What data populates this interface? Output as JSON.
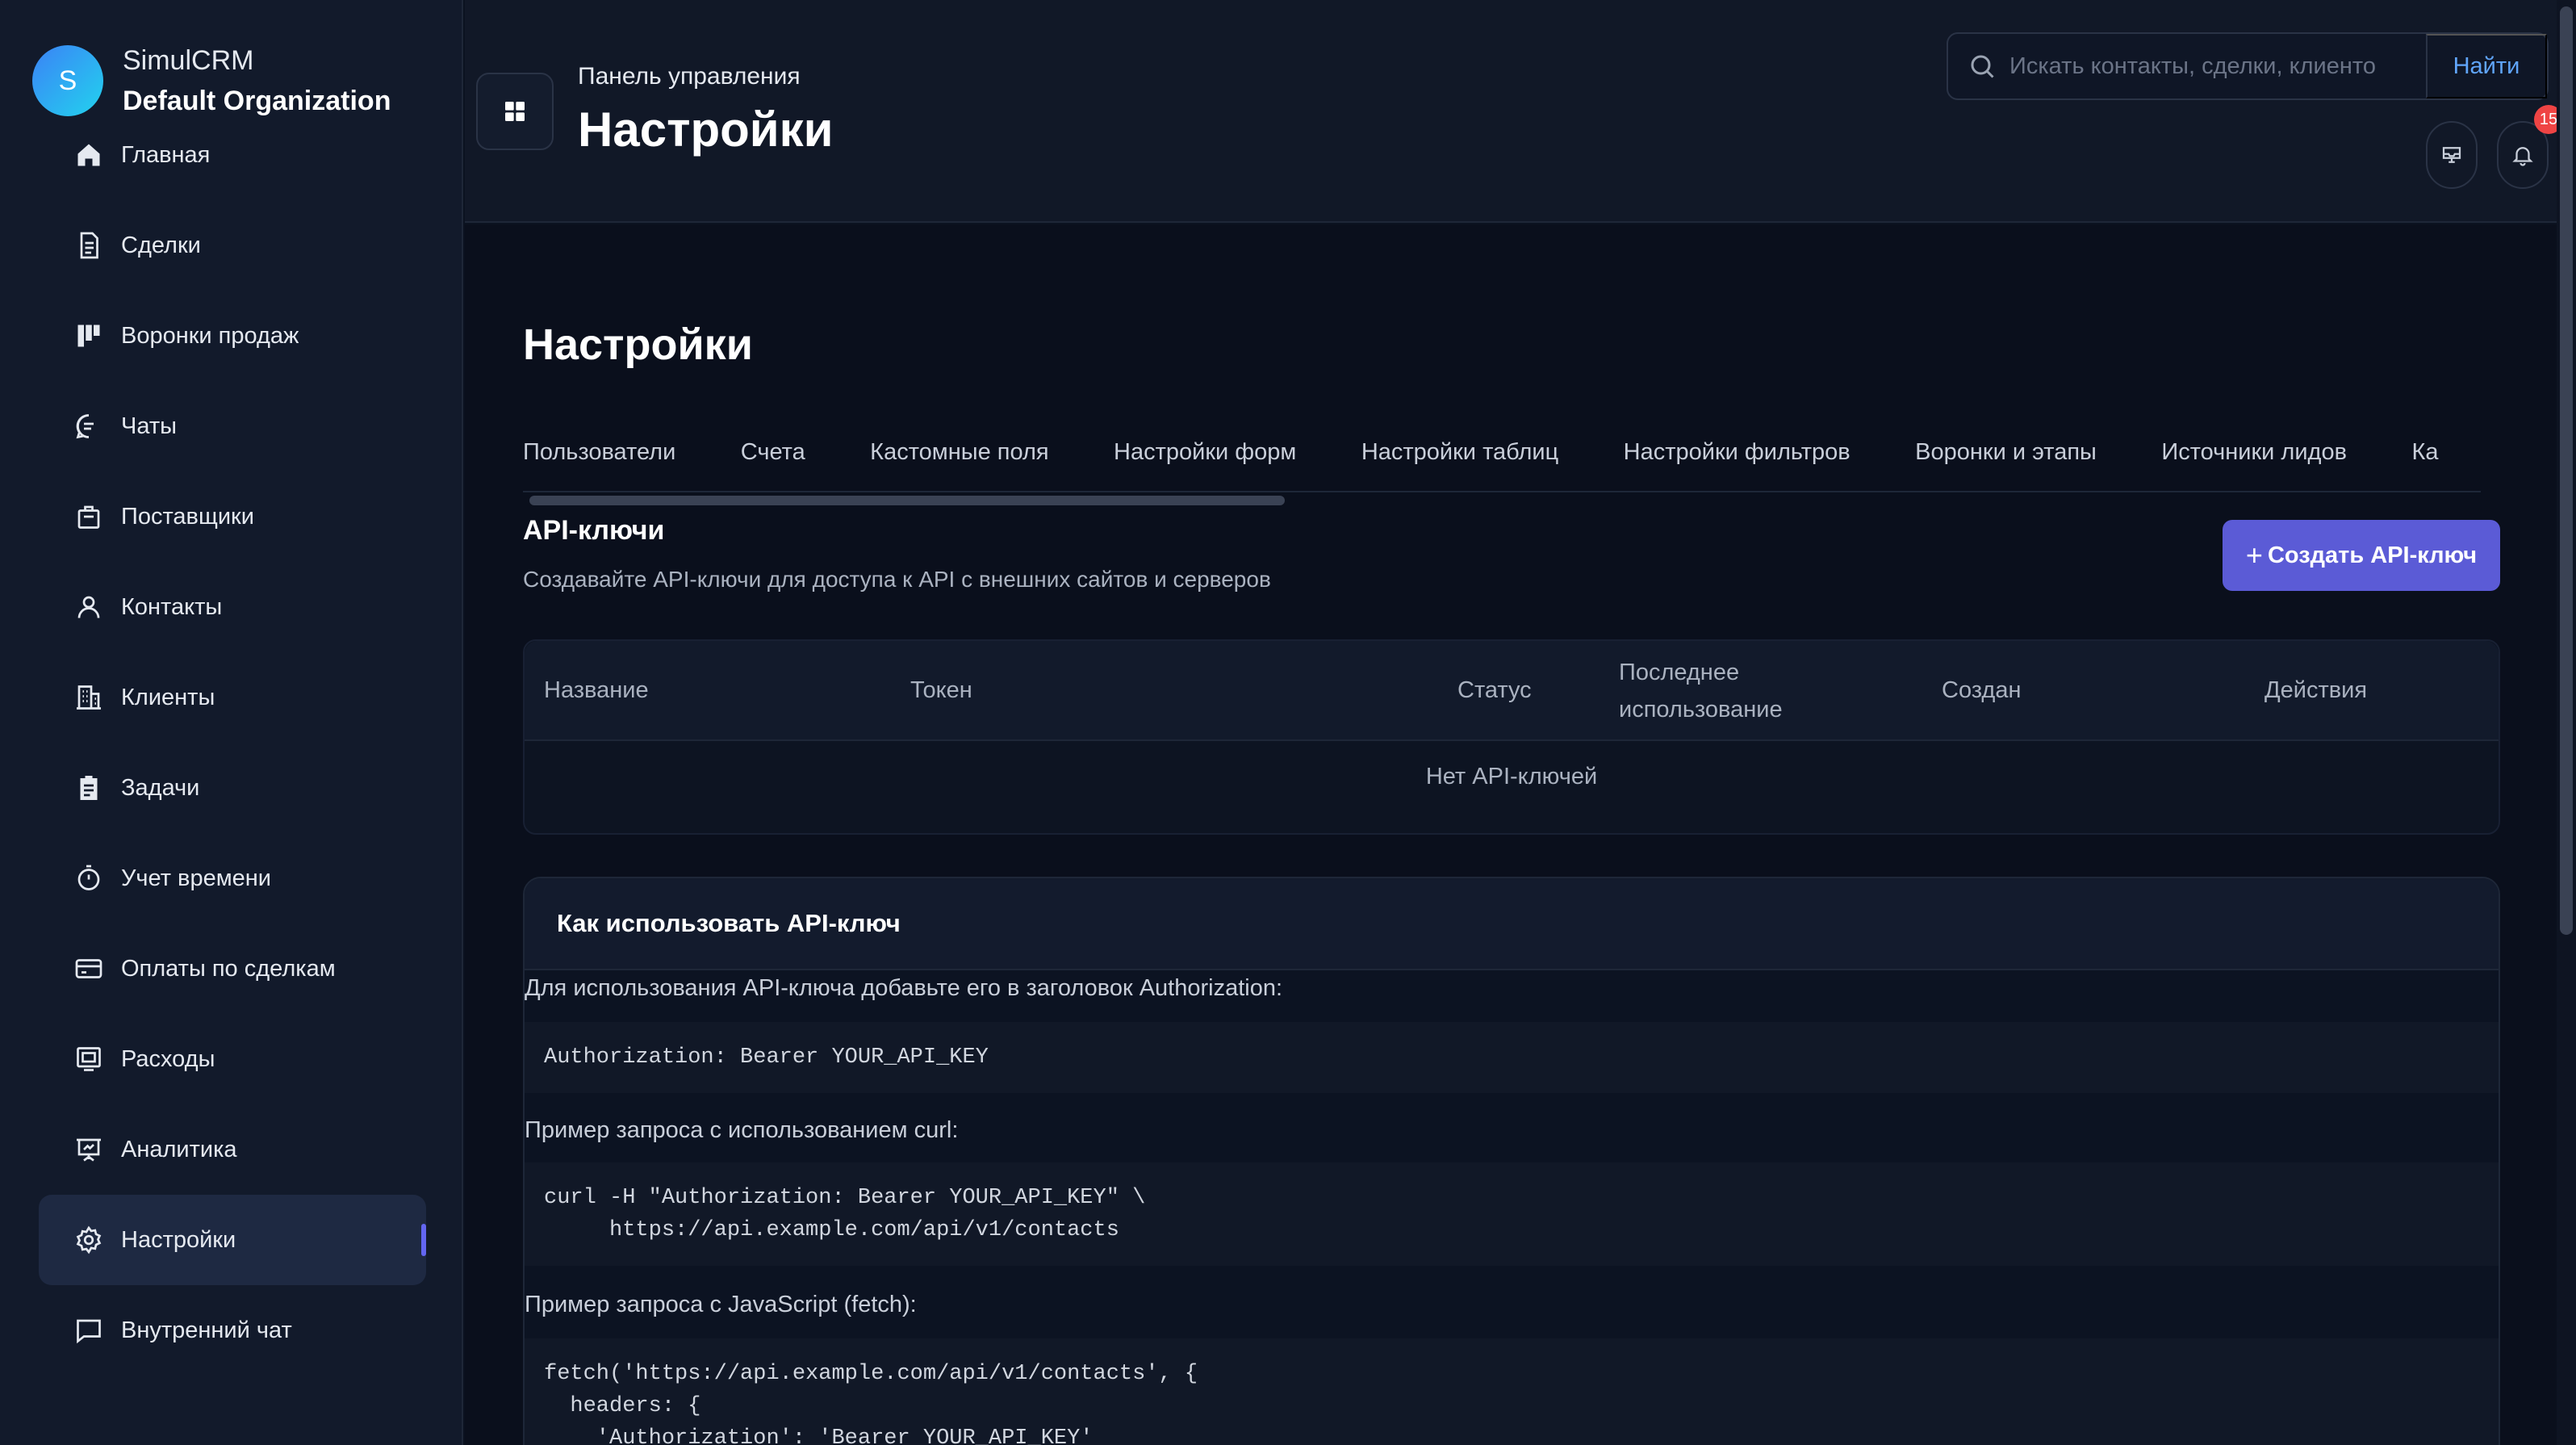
{
  "sidebar": {
    "avatar_letter": "S",
    "app_name": "SimulCRM",
    "org_name": "Default Organization",
    "items": [
      {
        "label": "Главная",
        "icon": "home-icon"
      },
      {
        "label": "Сделки",
        "icon": "document-icon"
      },
      {
        "label": "Воронки продаж",
        "icon": "funnel-icon"
      },
      {
        "label": "Чаты",
        "icon": "chat-icon"
      },
      {
        "label": "Поставщики",
        "icon": "briefcase-icon"
      },
      {
        "label": "Контакты",
        "icon": "user-icon"
      },
      {
        "label": "Клиенты",
        "icon": "building-icon"
      },
      {
        "label": "Задачи",
        "icon": "clipboard-icon"
      },
      {
        "label": "Учет времени",
        "icon": "stopwatch-icon"
      },
      {
        "label": "Оплаты по сделкам",
        "icon": "credit-card-icon"
      },
      {
        "label": "Расходы",
        "icon": "receipt-icon"
      },
      {
        "label": "Аналитика",
        "icon": "presentation-icon"
      },
      {
        "label": "Настройки",
        "icon": "gear-icon",
        "active": true
      },
      {
        "label": "Внутренний чат",
        "icon": "message-square-icon"
      }
    ]
  },
  "header": {
    "breadcrumb": "Панель управления",
    "title": "Настройки",
    "search_placeholder": "Искать контакты, сделки, клиенто",
    "search_button": "Найти",
    "notification_count": "15"
  },
  "page": {
    "title": "Настройки",
    "tabs": [
      "Пользователи",
      "Счета",
      "Кастомные поля",
      "Настройки форм",
      "Настройки таблиц",
      "Настройки фильтров",
      "Воронки и этапы",
      "Источники лидов",
      "Ка"
    ]
  },
  "api_keys": {
    "title": "API-ключи",
    "subtitle": "Создавайте API-ключи для доступа к API с внешних сайтов и серверов",
    "create_button": "Создать API-ключ",
    "columns": {
      "name": "Название",
      "token": "Токен",
      "status": "Статус",
      "last_used_1": "Последнее",
      "last_used_2": "использование",
      "created": "Создан",
      "actions": "Действия"
    },
    "empty": "Нет API-ключей"
  },
  "howto": {
    "title": "Как использовать API-ключ",
    "p1": "Для использования API-ключа добавьте его в заголовок Authorization:",
    "code1": "Authorization: Bearer YOUR_API_KEY",
    "p2": "Пример запроса с использованием curl:",
    "code2": "curl -H \"Authorization: Bearer YOUR_API_KEY\" \\\n     https://api.example.com/api/v1/contacts",
    "p3": "Пример запроса с JavaScript (fetch):",
    "code3": "fetch('https://api.example.com/api/v1/contacts', {\n  headers: {\n    'Authorization': 'Bearer YOUR_API_KEY'"
  },
  "colors": {
    "accent": "#5b5bd6",
    "background": "#0a0f1c",
    "sidebar": "#121a2b",
    "link": "#60a5fa",
    "badge": "#ef4444"
  }
}
